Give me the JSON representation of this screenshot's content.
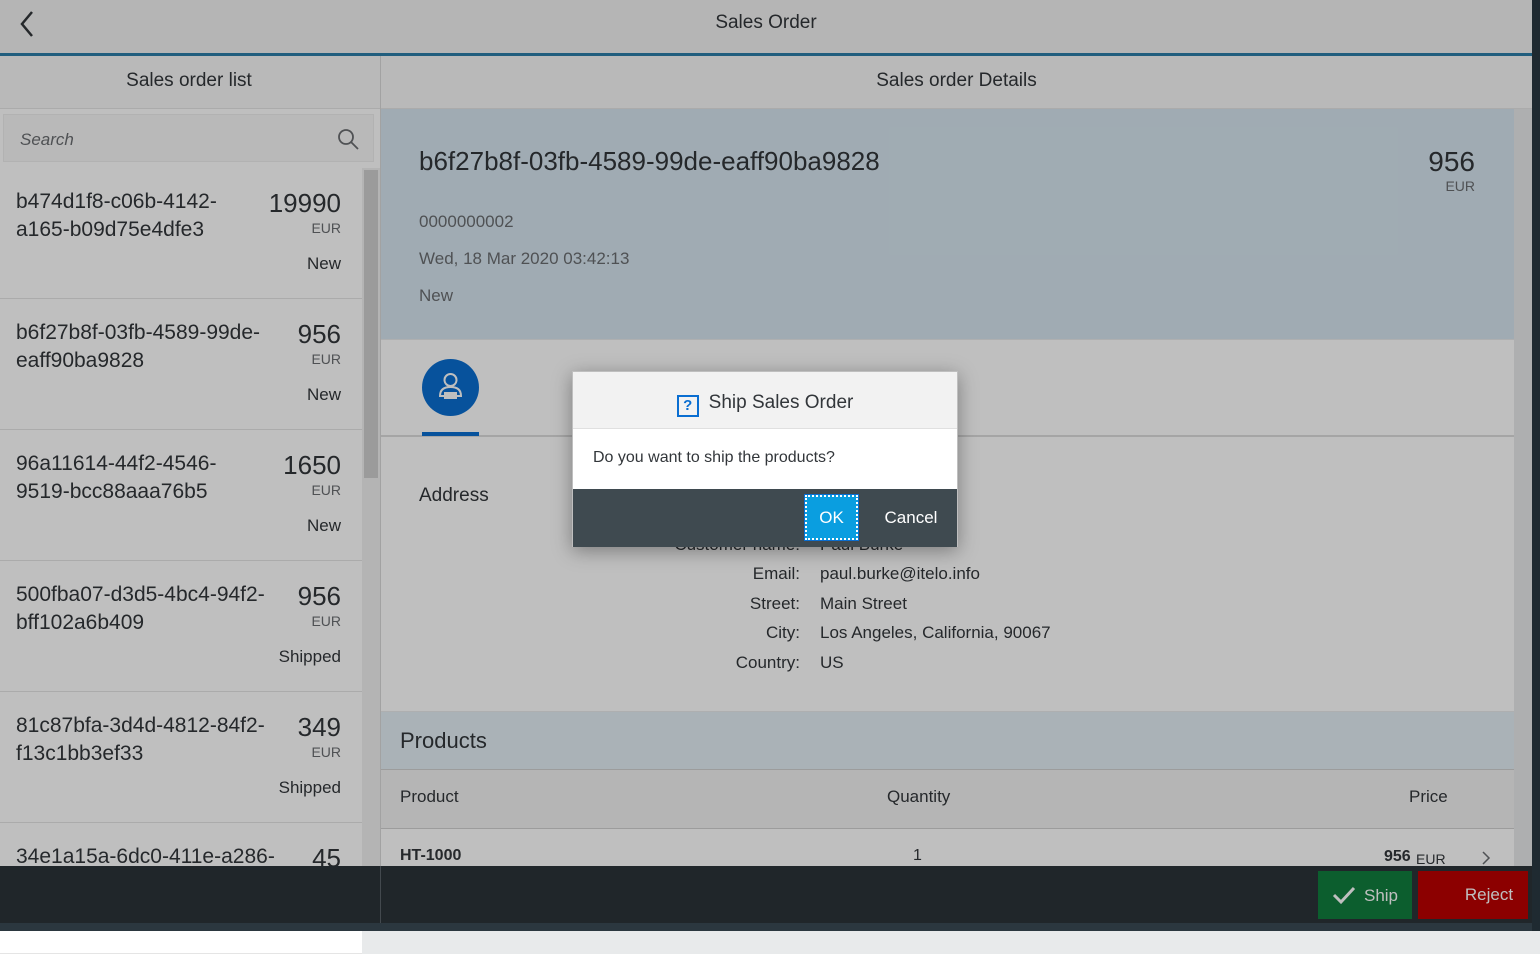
{
  "header": {
    "title": "Sales Order"
  },
  "master": {
    "title": "Sales order list",
    "search_placeholder": "Search",
    "items": [
      {
        "id": "b474d1f8-c06b-4142-a165-b09d75e4dfe3",
        "amount": "19990",
        "currency": "EUR",
        "status": "New"
      },
      {
        "id": "b6f27b8f-03fb-4589-99de-eaff90ba9828",
        "amount": "956",
        "currency": "EUR",
        "status": "New"
      },
      {
        "id": "96a11614-44f2-4546-9519-bcc88aaa76b5",
        "amount": "1650",
        "currency": "EUR",
        "status": "New"
      },
      {
        "id": "500fba07-d3d5-4bc4-94f2-bff102a6b409",
        "amount": "956",
        "currency": "EUR",
        "status": "Shipped"
      },
      {
        "id": "81c87bfa-3d4d-4812-84f2-f13c1bb3ef33",
        "amount": "349",
        "currency": "EUR",
        "status": "Shipped"
      },
      {
        "id": "34e1a15a-6dc0-411e-a286-",
        "amount": "45",
        "currency": "",
        "status": ""
      }
    ]
  },
  "detail": {
    "title": "Sales order Details",
    "object": {
      "title": "b6f27b8f-03fb-4589-99de-eaff90ba9828",
      "number": "956",
      "unit": "EUR",
      "sales_order_id": "0000000002",
      "created_at": "Wed, 18 Mar 2020 03:42:13",
      "status": "New"
    },
    "address": {
      "title": "Address",
      "fields": [
        {
          "label": "Customer name:",
          "value": "Paul Burke"
        },
        {
          "label": "Email:",
          "value": "paul.burke@itelo.info"
        },
        {
          "label": "Street:",
          "value": "Main Street"
        },
        {
          "label": "City:",
          "value": "Los Angeles, California, 90067"
        },
        {
          "label": "Country:",
          "value": "US"
        }
      ]
    },
    "products": {
      "title": "Products",
      "columns": {
        "product": "Product",
        "quantity": "Quantity",
        "price": "Price"
      },
      "rows": [
        {
          "product": "HT-1000",
          "quantity": "1",
          "price": "956",
          "currency": "EUR"
        }
      ]
    }
  },
  "footer": {
    "ship_label": "Ship",
    "reject_label": "Reject"
  },
  "dialog": {
    "title": "Ship Sales Order",
    "icon": "?",
    "message": "Do you want to ship the products?",
    "ok_label": "OK",
    "cancel_label": "Cancel"
  }
}
